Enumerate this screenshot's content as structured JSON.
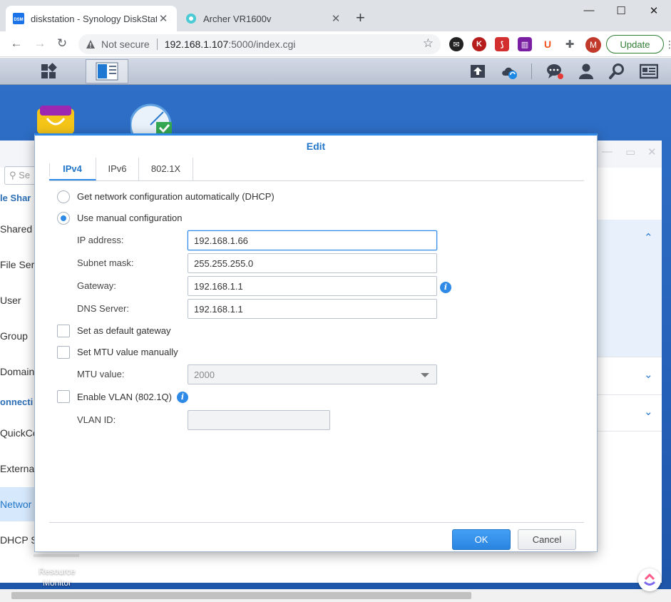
{
  "browser": {
    "tabs": [
      {
        "title": "diskstation - Synology DiskStation",
        "favicon": "dsm-icon",
        "active": true
      },
      {
        "title": "Archer VR1600v",
        "favicon": "tplink-icon",
        "active": false
      }
    ],
    "url": {
      "security_label": "Not secure",
      "host": "192.168.1.107",
      "path": ":5000/index.cgi"
    },
    "profile_initial": "M",
    "update_label": "Update",
    "extensions": [
      "K",
      "U"
    ]
  },
  "desktop": {
    "shortcut_label": "Resource Monitor",
    "bg_window": {
      "search_placeholder": "Se",
      "sidebar": {
        "section_1": "le Shar",
        "items_1": [
          "Shared",
          "File Ser",
          "User",
          "Group",
          "Domain"
        ],
        "section_2": "onnecti",
        "items_2": [
          "QuickCo",
          "Externa",
          "Networ",
          "DHCP S"
        ]
      }
    }
  },
  "dialog": {
    "title": "Edit",
    "tabs": [
      {
        "label": "IPv4",
        "active": true
      },
      {
        "label": "IPv6",
        "active": false
      },
      {
        "label": "802.1X",
        "active": false
      }
    ],
    "options": {
      "dhcp_label": "Get network configuration automatically (DHCP)",
      "manual_label": "Use manual configuration",
      "selected": "manual"
    },
    "fields": {
      "ip_label": "IP address:",
      "ip_value": "192.168.1.66",
      "subnet_label": "Subnet mask:",
      "subnet_value": "255.255.255.0",
      "gateway_label": "Gateway:",
      "gateway_value": "192.168.1.1",
      "dns_label": "DNS Server:",
      "dns_value": "192.168.1.1"
    },
    "checks": {
      "default_gw_label": "Set as default gateway",
      "default_gw_checked": false,
      "mtu_manual_label": "Set MTU value manually",
      "mtu_manual_checked": false,
      "vlan_label": "Enable VLAN (802.1Q)",
      "vlan_checked": false
    },
    "mtu": {
      "label": "MTU value:",
      "value": "2000"
    },
    "vlan": {
      "label": "VLAN ID:",
      "value": ""
    },
    "buttons": {
      "ok": "OK",
      "cancel": "Cancel"
    }
  },
  "colors": {
    "accent": "#2e8ae6",
    "title_blue": "#2276c9",
    "desktop_blue": "#2560b8"
  }
}
